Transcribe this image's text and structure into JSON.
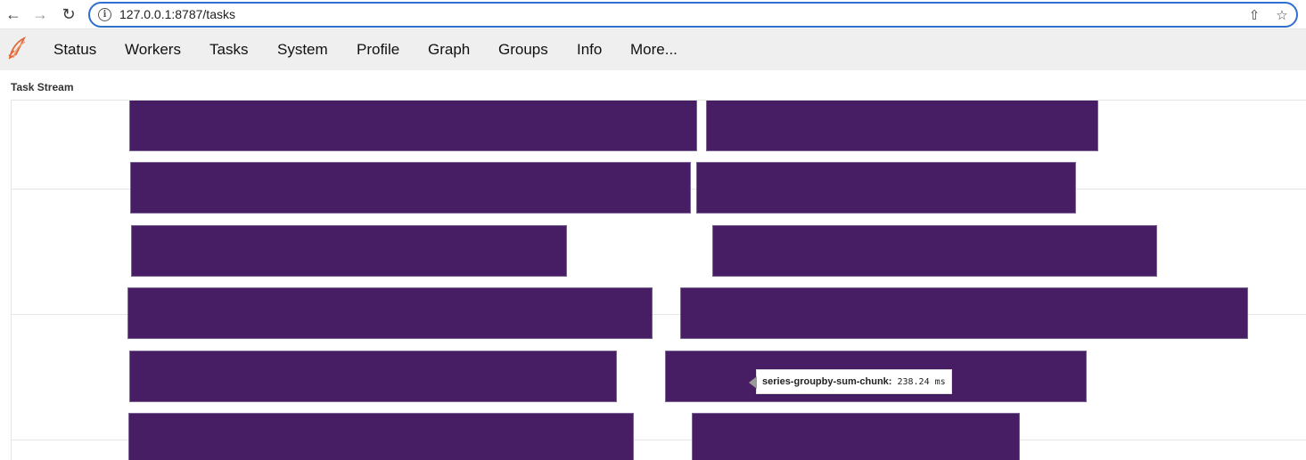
{
  "browser": {
    "url": "127.0.0.1:8787/tasks",
    "icons": {
      "back": "arrow-left-icon",
      "forward": "arrow-right-icon",
      "reload": "reload-icon",
      "info": "info-icon",
      "share": "share-icon",
      "bookmark": "star-icon"
    }
  },
  "navbar": {
    "logo_icon": "dask-logo-icon",
    "items": [
      {
        "label": "Status"
      },
      {
        "label": "Workers"
      },
      {
        "label": "Tasks"
      },
      {
        "label": "System"
      },
      {
        "label": "Profile"
      },
      {
        "label": "Graph"
      },
      {
        "label": "Groups"
      },
      {
        "label": "Info"
      },
      {
        "label": "More..."
      }
    ]
  },
  "task_stream": {
    "title": "Task Stream",
    "bar_color": "#471E63",
    "tooltip": {
      "label": "series-groupby-sum-chunk:",
      "value": "238.24 ms"
    }
  }
}
